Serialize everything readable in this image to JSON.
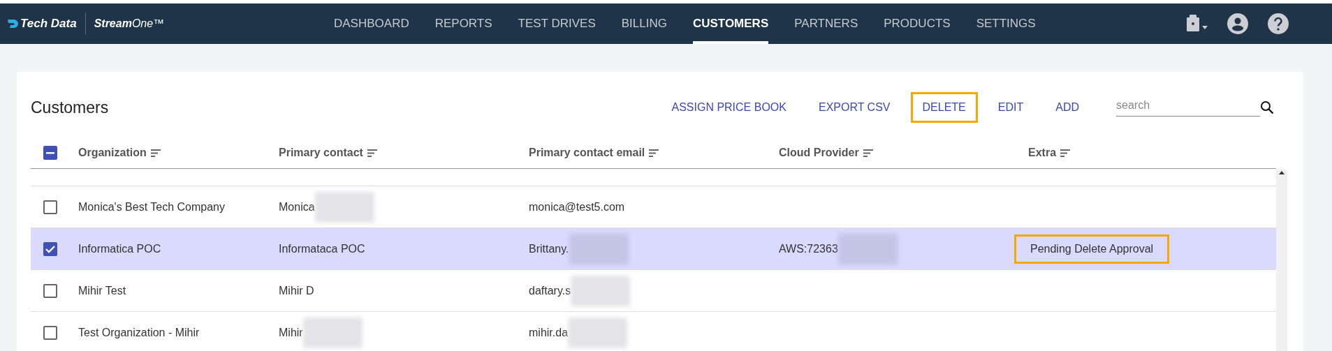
{
  "header": {
    "brand": "Tech Data",
    "product": "**Stream**One™",
    "nav": [
      {
        "label": "DASHBOARD",
        "selected": false
      },
      {
        "label": "REPORTS",
        "selected": false
      },
      {
        "label": "TEST DRIVES",
        "selected": false
      },
      {
        "label": "BILLING",
        "selected": false
      },
      {
        "label": "CUSTOMERS",
        "selected": true
      },
      {
        "label": "PARTNERS",
        "selected": false
      },
      {
        "label": "PRODUCTS",
        "selected": false
      },
      {
        "label": "SETTINGS",
        "selected": false
      }
    ]
  },
  "panel": {
    "title": "Customers",
    "actions": [
      {
        "label": "ASSIGN PRICE BOOK",
        "highlighted": false
      },
      {
        "label": "EXPORT CSV",
        "highlighted": false
      },
      {
        "label": "DELETE",
        "highlighted": true
      },
      {
        "label": "EDIT",
        "highlighted": false
      },
      {
        "label": "ADD",
        "highlighted": false
      }
    ],
    "search": {
      "placeholder": "search"
    }
  },
  "table": {
    "select_all": {
      "indeterminate": true
    },
    "columns": [
      "Organization",
      "Primary contact",
      "Primary contact email",
      "Cloud Provider",
      "Extra"
    ],
    "rows": [
      {
        "selected": false,
        "cells": [
          {
            "text": "Monica's Best Tech Company"
          },
          {
            "text": "Monica",
            "redacted": true
          },
          {
            "text": "monica@test5.com"
          },
          {},
          {}
        ]
      },
      {
        "selected": true,
        "cells": [
          {
            "text": "Informatica POC"
          },
          {
            "text": "Informataca POC"
          },
          {
            "text": "Brittany.",
            "redacted": true
          },
          {
            "text": "AWS:72363",
            "redacted": true
          },
          {
            "text": "Pending Delete Approval",
            "highlighted": true
          }
        ]
      },
      {
        "selected": false,
        "cells": [
          {
            "text": "Mihir Test"
          },
          {
            "text": "Mihir D"
          },
          {
            "text": "daftary.s",
            "redacted": true
          },
          {},
          {}
        ]
      },
      {
        "selected": false,
        "cells": [
          {
            "text": "Test Organization - Mihir"
          },
          {
            "text": "Mihir",
            "redacted": true
          },
          {
            "text": "mihir.da",
            "redacted": true
          },
          {},
          {}
        ]
      }
    ]
  }
}
